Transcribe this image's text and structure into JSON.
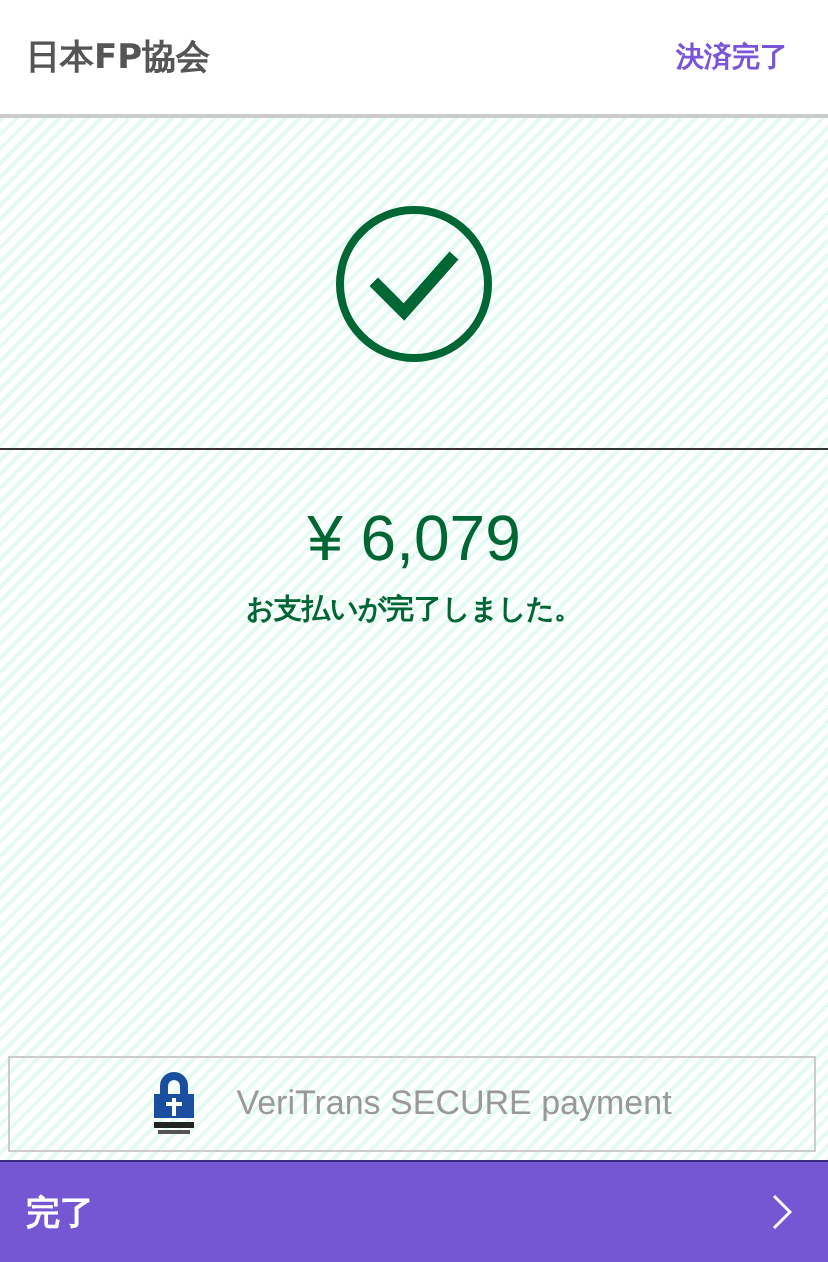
{
  "header": {
    "title": "日本FP協会",
    "status": "決済完了"
  },
  "result": {
    "amount": "¥ 6,079",
    "message": "お支払いが完了しました。"
  },
  "secure_badge": {
    "text": "VeriTrans SECURE payment"
  },
  "footer_button": {
    "label": "完了"
  }
}
